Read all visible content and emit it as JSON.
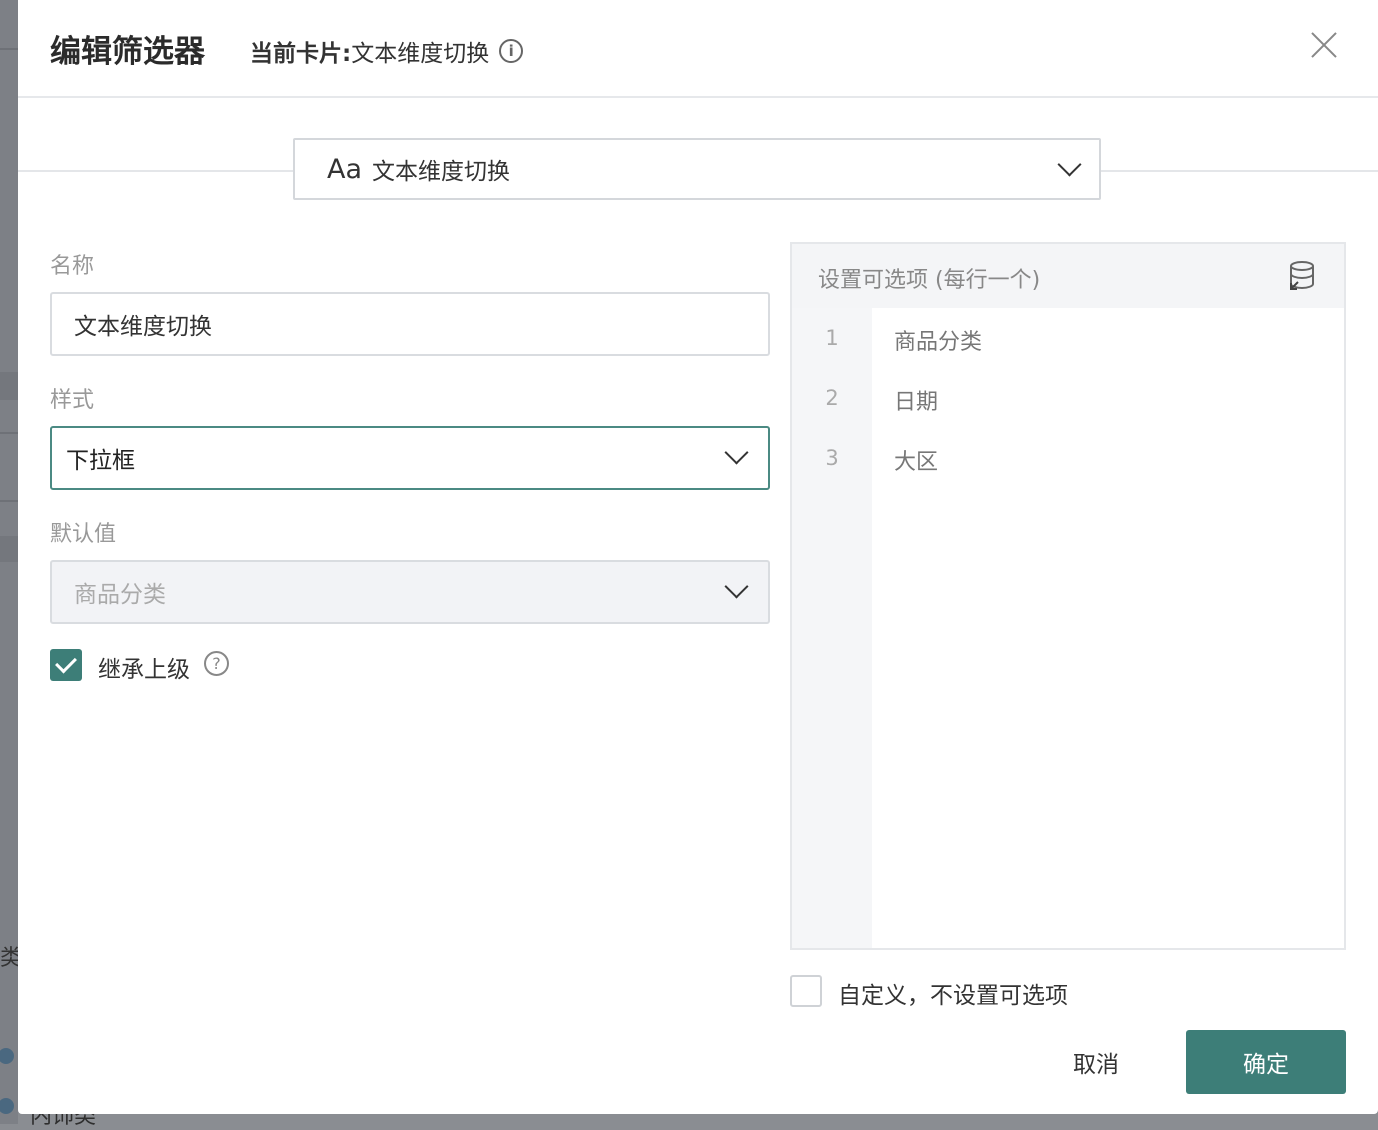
{
  "background": {
    "fragment_1": "类:",
    "fragment_2": "内饰类"
  },
  "dialog": {
    "title": "编辑筛选器",
    "current_card_label": "当前卡片:",
    "current_card_name": "文本维度切换",
    "filter_type_icon_text": "Aa",
    "filter_type_value": "文本维度切换"
  },
  "form": {
    "name_label": "名称",
    "name_value": "文本维度切换",
    "style_label": "样式",
    "style_value": "下拉框",
    "default_label": "默认值",
    "default_placeholder": "商品分类",
    "inherit_label": "继承上级",
    "inherit_checked": true
  },
  "options": {
    "title": "设置可选项 (每行一个)",
    "lines": [
      {
        "num": "1",
        "text": "商品分类"
      },
      {
        "num": "2",
        "text": "日期"
      },
      {
        "num": "3",
        "text": "大区"
      }
    ],
    "custom_label": "自定义，不设置可选项",
    "custom_checked": false
  },
  "footer": {
    "cancel_label": "取消",
    "confirm_label": "确定"
  },
  "colors": {
    "accent": "#3d7e78",
    "overlay": "#8a8d92"
  }
}
